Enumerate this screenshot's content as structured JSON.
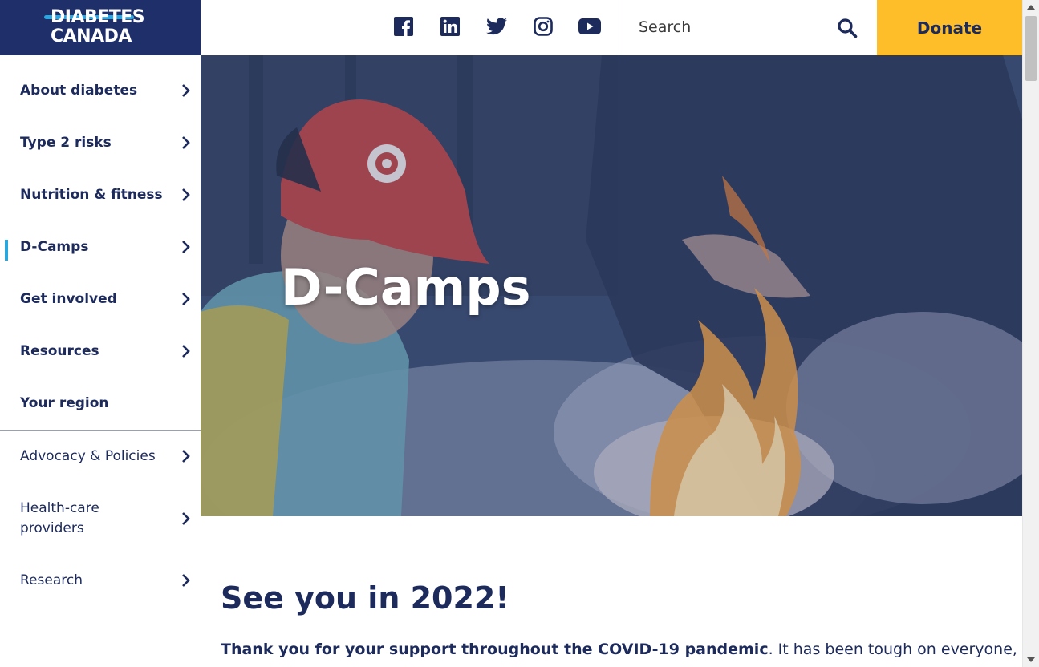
{
  "logo": {
    "line1": "DIABETES",
    "line2": "CANADA"
  },
  "header": {
    "social": [
      {
        "name": "facebook-icon"
      },
      {
        "name": "linkedin-icon"
      },
      {
        "name": "twitter-icon"
      },
      {
        "name": "instagram-icon"
      },
      {
        "name": "youtube-icon"
      }
    ],
    "search_placeholder": "Search",
    "donate_label": "Donate"
  },
  "sidebar": {
    "items": [
      {
        "label": "About diabetes"
      },
      {
        "label": "Type 2 risks"
      },
      {
        "label": "Nutrition & fitness"
      },
      {
        "label": "D-Camps"
      },
      {
        "label": "Get involved"
      },
      {
        "label": "Resources"
      },
      {
        "label": "Your region"
      }
    ],
    "secondary": [
      {
        "label": "Advocacy & Policies"
      },
      {
        "label": "Health-care providers"
      },
      {
        "label": "Research"
      }
    ]
  },
  "hero": {
    "title": "D-Camps"
  },
  "content": {
    "heading": "See you in 2022!",
    "para_bold": "Thank you for your support throughout the COVID-19 pandemic",
    "para_rest": ". It has been tough on everyone,"
  },
  "colors": {
    "navy": "#1c2a5c",
    "accent": "#27a8e0",
    "donate": "#fdbe2a"
  }
}
